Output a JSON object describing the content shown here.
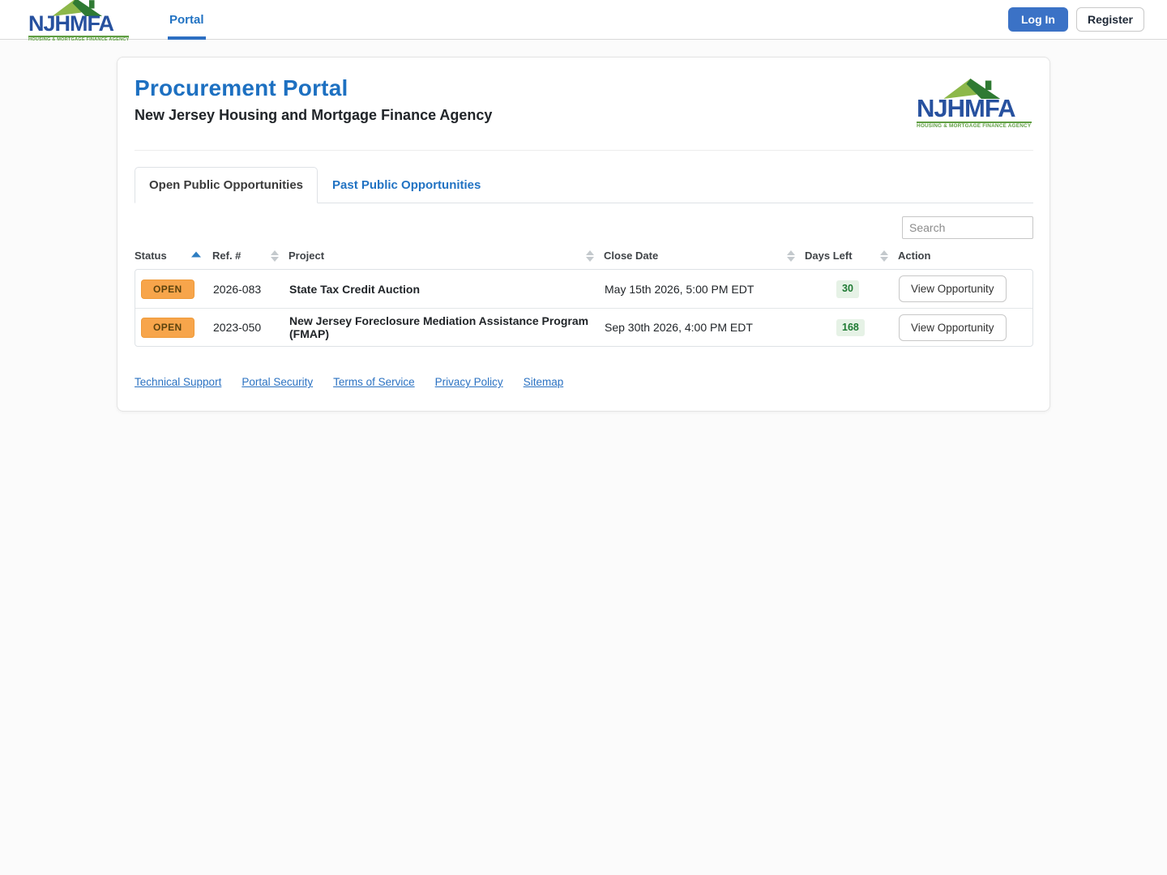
{
  "brand": {
    "name": "NJHMFA",
    "tagline": "HOUSING & MORTGAGE FINANCE AGENCY"
  },
  "navbar": {
    "portal_link": "Portal",
    "login_label": "Log In",
    "register_label": "Register"
  },
  "card": {
    "title": "Procurement Portal",
    "subtitle": "New Jersey Housing and Mortgage Finance Agency",
    "tabs": [
      {
        "label": "Open Public Opportunities",
        "active": true
      },
      {
        "label": "Past Public Opportunities",
        "active": false
      }
    ],
    "search": {
      "placeholder": "Search",
      "value": ""
    },
    "table": {
      "columns": [
        "Status",
        "Ref. #",
        "Project",
        "Close Date",
        "Days Left",
        "Action"
      ],
      "sort": {
        "column": "Status",
        "direction": "ascending"
      },
      "rows": [
        {
          "status": "OPEN",
          "ref": "2026-083",
          "project": "State Tax Credit Auction",
          "close_date": "May 15th 2026, 5:00 PM EDT",
          "days_left": "30",
          "action": "View Opportunity"
        },
        {
          "status": "OPEN",
          "ref": "2023-050",
          "project": "New Jersey Foreclosure Mediation Assistance Program (FMAP)",
          "close_date": "Sep 30th 2026, 4:00 PM EDT",
          "days_left": "168",
          "action": "View Opportunity"
        }
      ]
    },
    "footer_links": [
      "Technical Support",
      "Portal Security",
      "Terms of Service",
      "Privacy Policy",
      "Sitemap"
    ]
  },
  "colors": {
    "accent_blue": "#1d70c1",
    "link_blue": "#2273c3",
    "login_button_blue": "#3b72c6",
    "status_badge_orange": "#f7a54b",
    "days_badge_bg_green": "#e6f2e6",
    "days_badge_text_green": "#1f7a33",
    "brand_navy": "#27519f",
    "brand_green": "#5f9e42"
  }
}
